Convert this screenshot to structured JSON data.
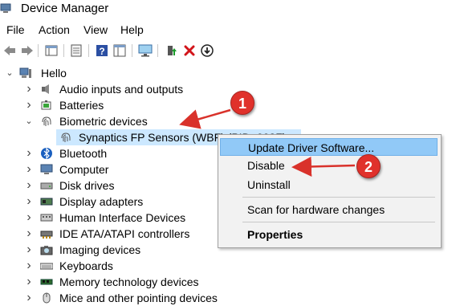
{
  "window": {
    "title": "Device Manager"
  },
  "menu": [
    "File",
    "Action",
    "View",
    "Help"
  ],
  "toolbar": [
    "back-icon",
    "forward-icon",
    "properties-grid-icon",
    "show-hidden-icon",
    "help-icon",
    "console-tree-icon",
    "scan-monitor-icon",
    "update-driver-icon",
    "uninstall-x-icon",
    "disable-download-icon"
  ],
  "tree": {
    "root": "Hello",
    "items": [
      {
        "label": "Audio inputs and outputs",
        "icon": "speaker-icon"
      },
      {
        "label": "Batteries",
        "icon": "battery-icon"
      },
      {
        "label": "Biometric devices",
        "icon": "fingerprint-icon",
        "expanded": true
      },
      {
        "label": "Synaptics FP Sensors (WBF) (PID=003F)",
        "icon": "fingerprint-icon",
        "child": true,
        "selected": true
      },
      {
        "label": "Bluetooth",
        "icon": "bluetooth-icon"
      },
      {
        "label": "Computer",
        "icon": "computer-icon"
      },
      {
        "label": "Disk drives",
        "icon": "disk-drive-icon"
      },
      {
        "label": "Display adapters",
        "icon": "display-adapter-icon"
      },
      {
        "label": "Human Interface Devices",
        "icon": "hid-icon"
      },
      {
        "label": "IDE ATA/ATAPI controllers",
        "icon": "ide-controller-icon"
      },
      {
        "label": "Imaging devices",
        "icon": "camera-icon"
      },
      {
        "label": "Keyboards",
        "icon": "keyboard-icon"
      },
      {
        "label": "Memory technology devices",
        "icon": "memory-icon"
      },
      {
        "label": "Mice and other pointing devices",
        "icon": "mouse-icon"
      }
    ]
  },
  "context_menu": {
    "update": "Update Driver Software...",
    "disable": "Disable",
    "uninstall": "Uninstall",
    "scan": "Scan for hardware changes",
    "properties": "Properties"
  },
  "callouts": {
    "one": "1",
    "two": "2"
  },
  "colors": {
    "selection": "#cce8ff",
    "menu_highlight": "#91c9f7",
    "callout": "#e0312b",
    "arrow": "#d9322b"
  }
}
